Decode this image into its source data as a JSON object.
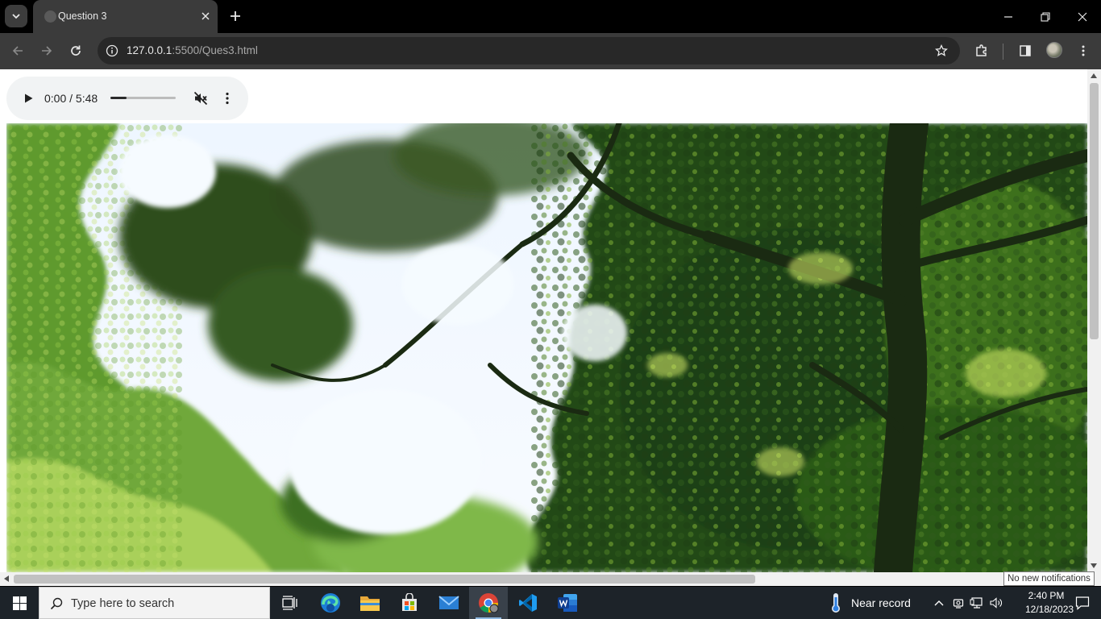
{
  "browser": {
    "tab": {
      "title": "Question 3"
    },
    "address": {
      "host": "127.0.0.1",
      "path": ":5500/Ques3.html"
    }
  },
  "audio": {
    "time": "0:00 / 5:48",
    "volume_level": 0.25,
    "muted": true
  },
  "page": {
    "image_description": "Photo of tree canopy with green leaves against a bright sky"
  },
  "tooltip": {
    "text": "No new notifications"
  },
  "taskbar": {
    "search_placeholder": "Type here to search",
    "weather": "Near record",
    "time": "2:40 PM",
    "date": "12/18/2023",
    "apps": [
      "task-view",
      "edge",
      "file-explorer",
      "microsoft-store",
      "mail",
      "chrome",
      "vs-code",
      "word"
    ]
  },
  "colors": {
    "chrome_dark": "#3b3b3b",
    "taskbar": "#1d2329",
    "audio_bg": "#f1f3f4"
  }
}
